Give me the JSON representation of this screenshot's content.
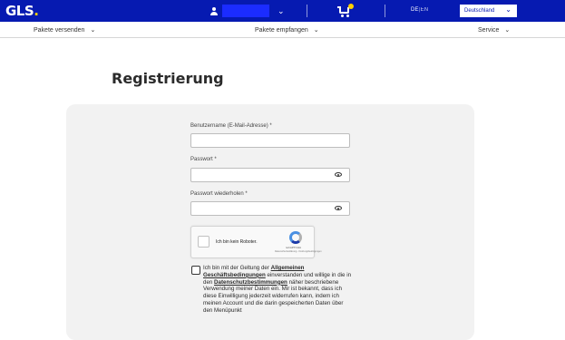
{
  "header": {
    "logo_text": "GLS",
    "logo_dot": ".",
    "user_chevron": "⌄",
    "lang_active": "DE",
    "lang_separator": "|",
    "lang_other": "EN",
    "country_select": "Deutschland",
    "country_chevron": "⌄",
    "brand_color": "#061ab1",
    "accent_color": "#ffd100"
  },
  "nav": {
    "items": [
      {
        "label": "Pakete versenden",
        "chevron": "⌄"
      },
      {
        "label": "Pakete empfangen",
        "chevron": "⌄"
      },
      {
        "label": "Service",
        "chevron": "⌄"
      }
    ]
  },
  "form": {
    "title": "Registrierung",
    "username_label": "Benutzername (E-Mail-Adresse) *",
    "username_value": "",
    "password_label": "Passwort *",
    "password_value": "",
    "password_repeat_label": "Passwort wiederholen *",
    "password_repeat_value": "",
    "captcha": {
      "label": "Ich bin kein Roboter.",
      "brand": "reCAPTCHA",
      "links": "Datenschutzerklärung - Nutzungsbedingungen"
    },
    "consent": {
      "text_1": "Ich bin mit der Geltung der ",
      "link_1": "Allgemeinen Geschäftsbedingungen",
      "text_2": " einverstanden und willige in die in den ",
      "link_2": "Datenschutzbestimmungen",
      "text_3": " näher beschriebene Verwendung meiner Daten ein. Mir ist bekannt, dass ich diese Einwilligung jederzeit widerrufen kann, indem ich meinen Account und die darin gespeicherten Daten über den Menüpunkt"
    }
  }
}
